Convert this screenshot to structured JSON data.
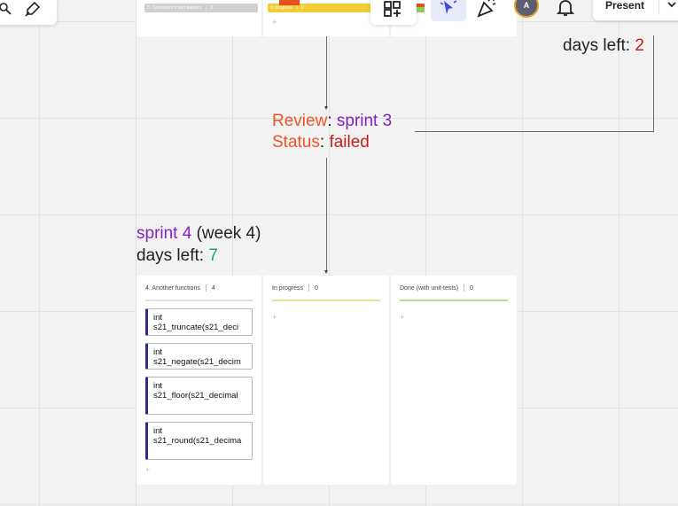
{
  "top_cols": {
    "c1_header": "3. Conversions and parsers",
    "c1_count": "0",
    "c2_header": "In progress",
    "c2_count": "0"
  },
  "sprint3": {
    "days_label": "days left: ",
    "days_value": "2",
    "review_label": "Review",
    "review_value": "sprint 3",
    "status_label": "Status",
    "status_value": "failed",
    "colon": ": "
  },
  "sprint4": {
    "title": "sprint 4",
    "week": " (week 4)",
    "days_label": "days left: ",
    "days_value": "7"
  },
  "board": {
    "col1_header": "4. Another functions",
    "col1_count": "4",
    "col2_header": "In progress",
    "col2_count": "0",
    "col3_header": "Done (with unit-tests)",
    "col3_count": "0",
    "cards": [
      {
        "line1": "int",
        "line2": "s21_truncate(s21_deci"
      },
      {
        "line1": "int",
        "line2": "s21_negate(s21_decim"
      },
      {
        "line1": "int",
        "line2": "s21_floor(s21_decimal"
      },
      {
        "line1": "int",
        "line2": "s21_round(s21_decima"
      }
    ],
    "plus": "+"
  },
  "toolbar": {
    "avatar_letter": "A",
    "present_label": "Present"
  },
  "colors": {
    "purple": "#8a1fc4",
    "orange": "#f0522a",
    "red": "#c0201c",
    "teal": "#18a08c",
    "yellow_rule": "#e6e29a",
    "green_rule": "#b5dd8f",
    "accent_blue": "#3a4be0"
  }
}
